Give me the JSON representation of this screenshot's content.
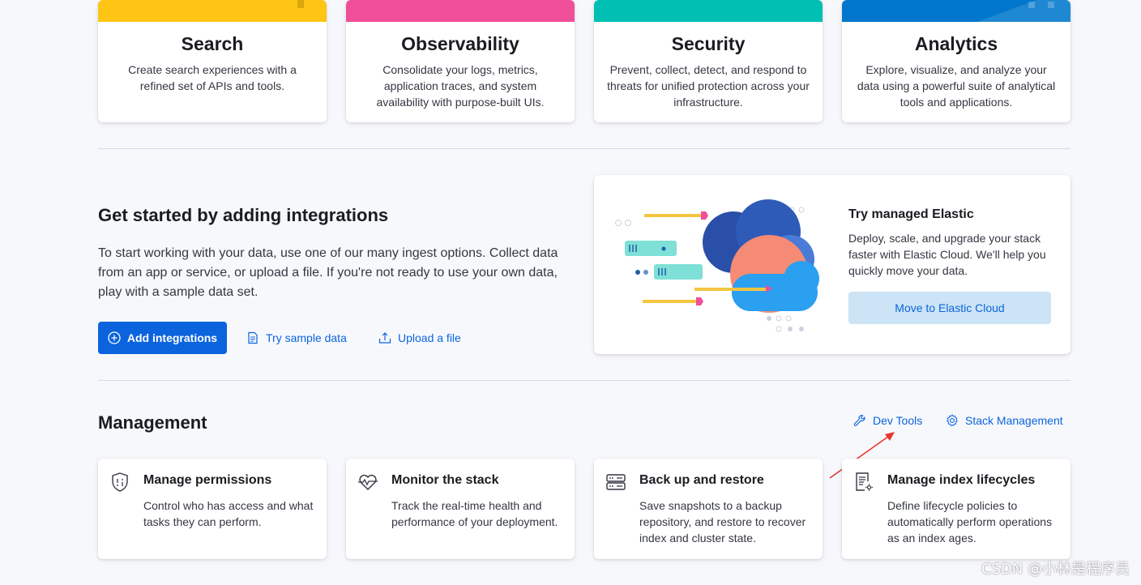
{
  "solutions": [
    {
      "title": "Search",
      "description": "Create search experiences with a refined set of APIs and tools.",
      "color": "#fec514"
    },
    {
      "title": "Observability",
      "description": "Consolidate your logs, metrics, application traces, and system availability with purpose-built UIs.",
      "color": "#f04e98"
    },
    {
      "title": "Security",
      "description": "Prevent, collect, detect, and respond to threats for unified protection across your infrastructure.",
      "color": "#00bfb3"
    },
    {
      "title": "Analytics",
      "description": "Explore, visualize, and analyze your data using a powerful suite of analytical tools and applications.",
      "color": "#0077cc"
    }
  ],
  "integrations": {
    "title": "Get started by adding integrations",
    "description": "To start working with your data, use one of our many ingest options. Collect data from an app or service, or upload a file. If you're not ready to use your own data, play with a sample data set.",
    "add_button": "Add integrations",
    "sample_link": "Try sample data",
    "upload_link": "Upload a file"
  },
  "cloud": {
    "title": "Try managed Elastic",
    "description": "Deploy, scale, and upgrade your stack faster with Elastic Cloud. We'll help you quickly move your data.",
    "button": "Move to Elastic Cloud"
  },
  "management": {
    "title": "Management",
    "dev_tools": "Dev Tools",
    "stack_management": "Stack Management",
    "cards": [
      {
        "title": "Manage permissions",
        "description": "Control who has access and what tasks they can perform.",
        "icon": "shield-icon"
      },
      {
        "title": "Monitor the stack",
        "description": "Track the real-time health and performance of your deployment.",
        "icon": "heartbeat-icon"
      },
      {
        "title": "Back up and restore",
        "description": "Save snapshots to a backup repository, and restore to recover index and cluster state.",
        "icon": "storage-icon"
      },
      {
        "title": "Manage index lifecycles",
        "description": "Define lifecycle policies to automatically perform operations as an index ages.",
        "icon": "document-gear-icon"
      }
    ]
  },
  "watermark": "CSDN @小林是程序员",
  "colors": {
    "accent": "#0b64dd",
    "annotation_arrow": "#e8352a"
  }
}
